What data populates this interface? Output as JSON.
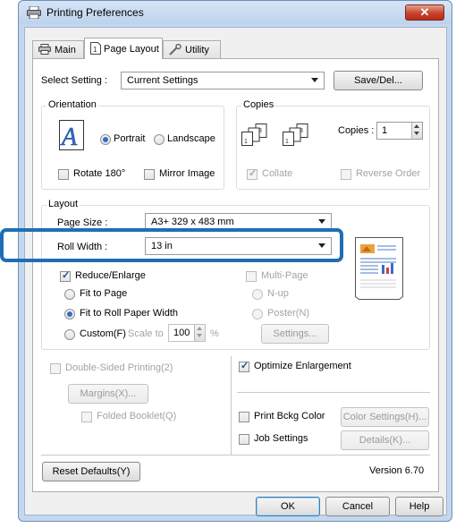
{
  "window": {
    "title": "Printing Preferences",
    "close_symbol": "✕"
  },
  "tabs": [
    {
      "label": "Main",
      "icon": "printer-icon"
    },
    {
      "label": "Page Layout",
      "icon": "page-icon",
      "active": true
    },
    {
      "label": "Utility",
      "icon": "wrench-icon"
    }
  ],
  "select_setting": {
    "label": "Select Setting :",
    "value": "Current Settings",
    "save_label": "Save/Del..."
  },
  "orientation": {
    "label": "Orientation",
    "portrait": "Portrait",
    "landscape": "Landscape",
    "selected": "Portrait",
    "rotate": "Rotate 180°",
    "mirror": "Mirror Image"
  },
  "copies": {
    "label": "Copies",
    "copies_label": "Copies :",
    "value": "1",
    "collate": "Collate",
    "collate_checked": true,
    "reverse": "Reverse Order"
  },
  "layout": {
    "label": "Layout",
    "page_size_label": "Page Size :",
    "page_size_value": "A3+ 329 x 483 mm",
    "roll_width_label": "Roll Width :",
    "roll_width_value": "13 in",
    "reduce_enlarge": "Reduce/Enlarge",
    "reduce_enlarge_checked": true,
    "fit_to_page": "Fit to Page",
    "fit_roll": "Fit to Roll Paper Width",
    "custom": "Custom(F)",
    "scale_to": "Scale to",
    "scale_value": "100",
    "percent": "%",
    "selected": "Fit to Roll Paper Width",
    "multi_page": "Multi-Page",
    "n_up": "N-up",
    "poster": "Poster(N)",
    "settings": "Settings..."
  },
  "double_sided": {
    "label": "Double-Sided Printing(2)",
    "margins": "Margins(X)...",
    "folded": "Folded Booklet(Q)"
  },
  "options": {
    "optimize": "Optimize Enlargement",
    "optimize_checked": true,
    "print_bckg": "Print Bckg Color",
    "color_settings": "Color Settings(H)...",
    "job_settings": "Job Settings",
    "details": "Details(K)..."
  },
  "footer": {
    "reset": "Reset Defaults(Y)",
    "version": "Version 6.70",
    "ok": "OK",
    "cancel": "Cancel",
    "help": "Help"
  },
  "colors": {
    "highlight": "#1e6eb5",
    "close_button": "#c8412c",
    "accent": "#2f6fd0"
  }
}
